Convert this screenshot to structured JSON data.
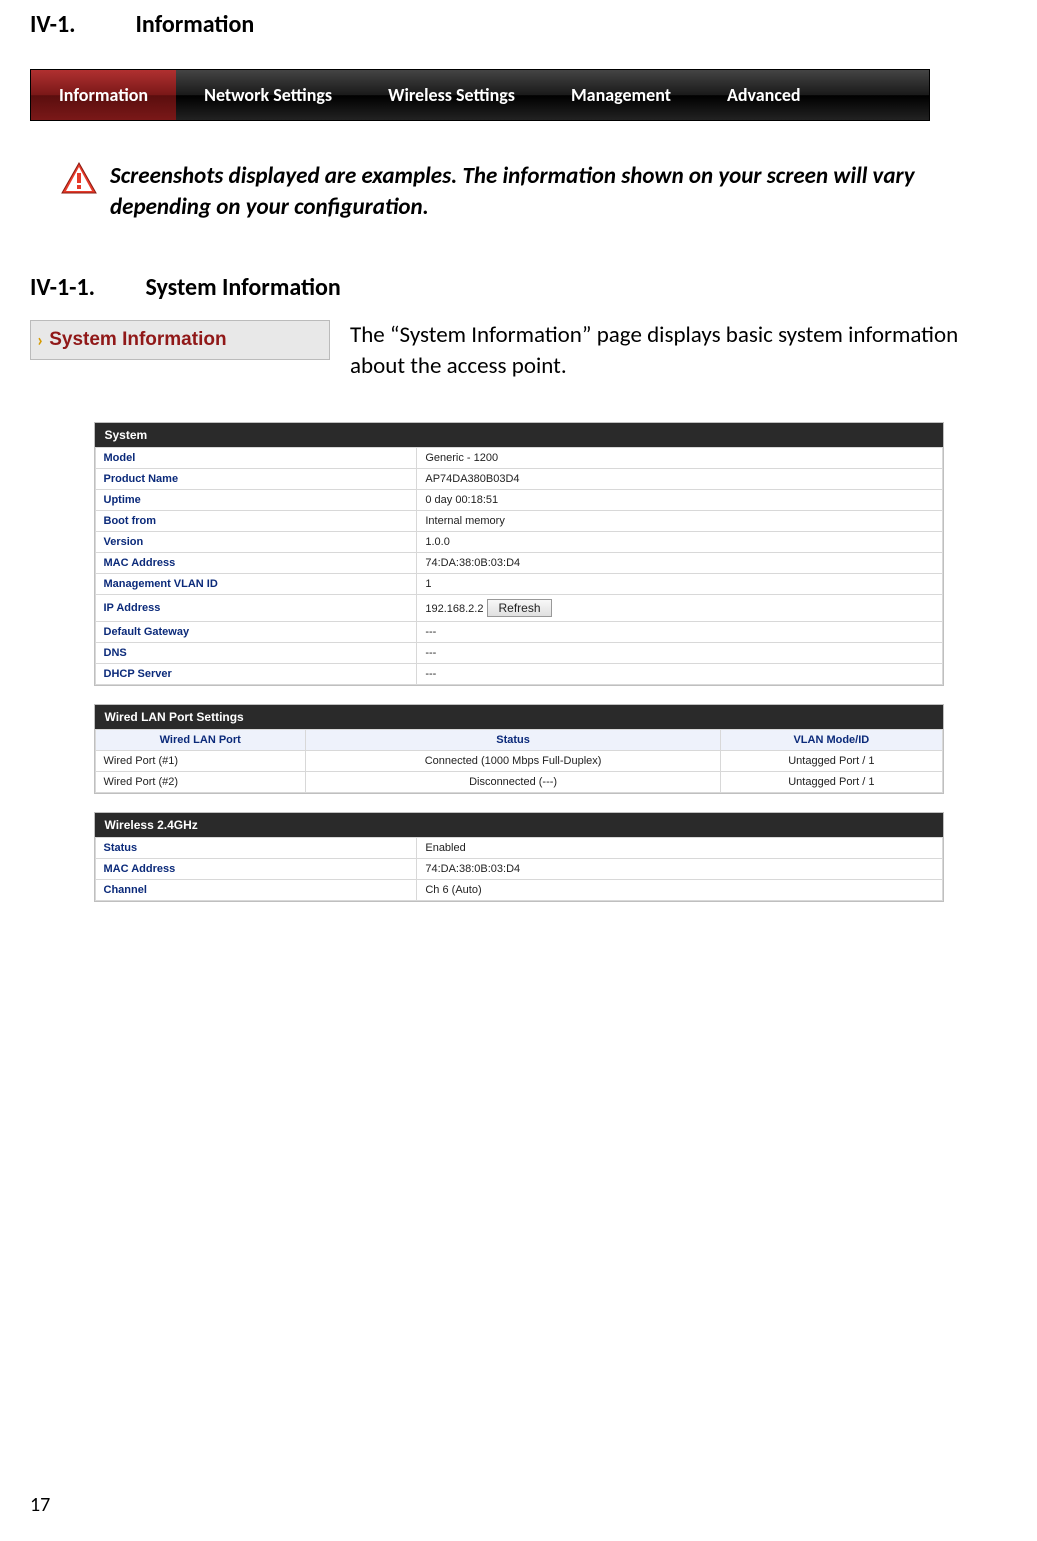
{
  "headings": {
    "section_num": "IV-1.",
    "section_title": "Information",
    "subsection_num": "IV-1-1.",
    "subsection_title": "System Information"
  },
  "nav": {
    "tabs": [
      "Information",
      "Network Settings",
      "Wireless Settings",
      "Management",
      "Advanced"
    ],
    "active_index": 0
  },
  "warning": {
    "text": "Screenshots displayed are examples. The information shown on your screen will vary depending on your configuration."
  },
  "sysinfo_tab": {
    "label": "System Information"
  },
  "sysinfo_desc": "The “System Information” page displays basic system information about the access point.",
  "system_block": {
    "title": "System",
    "rows": [
      {
        "key": "Model",
        "val": "Generic - 1200"
      },
      {
        "key": "Product Name",
        "val": "AP74DA380B03D4"
      },
      {
        "key": "Uptime",
        "val": " 0 day 00:18:51"
      },
      {
        "key": "Boot from",
        "val": "Internal memory"
      },
      {
        "key": "Version",
        "val": "1.0.0"
      },
      {
        "key": "MAC Address",
        "val": "74:DA:38:0B:03:D4"
      },
      {
        "key": "Management VLAN ID",
        "val": "1"
      },
      {
        "key": "IP Address",
        "val": "192.168.2.2",
        "refresh": true
      },
      {
        "key": "Default Gateway",
        "val": "---"
      },
      {
        "key": "DNS",
        "val": "---"
      },
      {
        "key": "DHCP Server",
        "val": "---"
      }
    ],
    "refresh_label": "Refresh"
  },
  "wired_block": {
    "title": "Wired LAN Port Settings",
    "columns": [
      "Wired LAN Port",
      "Status",
      "VLAN Mode/ID"
    ],
    "rows": [
      {
        "port": "Wired Port (#1)",
        "status": "Connected (1000 Mbps Full-Duplex)",
        "vlan": "Untagged Port  /   1"
      },
      {
        "port": "Wired Port (#2)",
        "status": "Disconnected (---)",
        "vlan": "Untagged Port  /   1"
      }
    ]
  },
  "wireless_block": {
    "title": "Wireless 2.4GHz",
    "rows": [
      {
        "key": "Status",
        "val": "Enabled"
      },
      {
        "key": "MAC Address",
        "val": "74:DA:38:0B:03:D4"
      },
      {
        "key": "Channel",
        "val": "Ch 6 (Auto)"
      }
    ]
  },
  "page_number": "17"
}
